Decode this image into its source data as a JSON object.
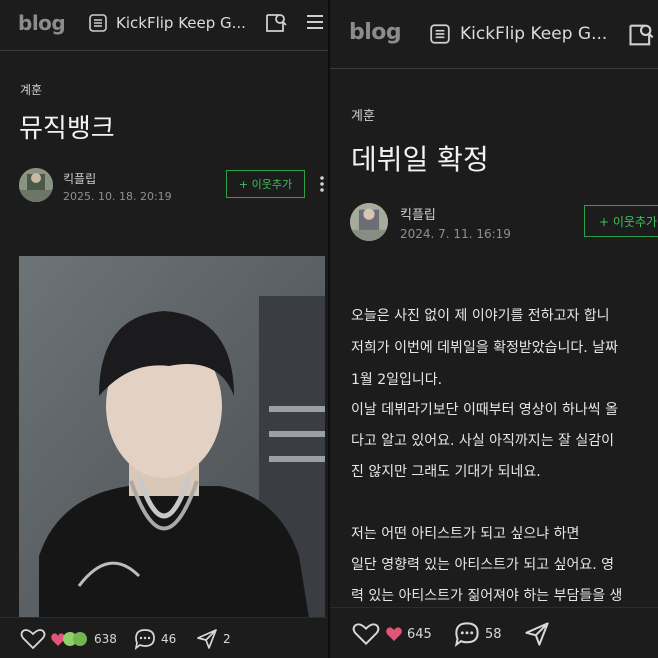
{
  "left": {
    "logo": "blog",
    "blog_title": "KickFlip Keep G...",
    "category": "계훈",
    "post_title": "뮤직뱅크",
    "author": "킥플립",
    "date": "2025. 10. 18. 20:19",
    "add_neighbor_label": "+ 이웃추가",
    "likes_count": "638",
    "comments_count": "46",
    "shares_count": "2"
  },
  "right": {
    "logo": "blog",
    "blog_title": "KickFlip Keep G...",
    "category": "계훈",
    "post_title": "데뷔일 확정",
    "author": "킥플립",
    "date": "2024. 7. 11. 16:19",
    "add_neighbor_label": "+ 이웃추가",
    "body_lines": [
      "오늘은 사진 없이 제 이야기를 전하고자 합니",
      "저희가 이번에 데뷔일을 확정받았습니다. 날짜",
      "1월 2일입니다.",
      "이날 데뷔라기보단 이때부터 영상이 하나씩 올",
      "다고 알고 있어요. 사실 아직까지는 잘 실감이",
      "진 않지만 그래도 기대가 되네요.",
      "",
      "저는 어떤 아티스트가 되고 싶으냐 하면",
      "일단 영향력 있는 아티스트가 되고 싶어요. 영",
      "력 있는 아티스트가 짊어져야 하는 부담들을 생"
    ],
    "likes_count": "645",
    "comments_count": "58"
  },
  "colors": {
    "background": "#1c1c1c",
    "accent_green": "#3ec25c",
    "heart_pink": "#e0557a"
  }
}
